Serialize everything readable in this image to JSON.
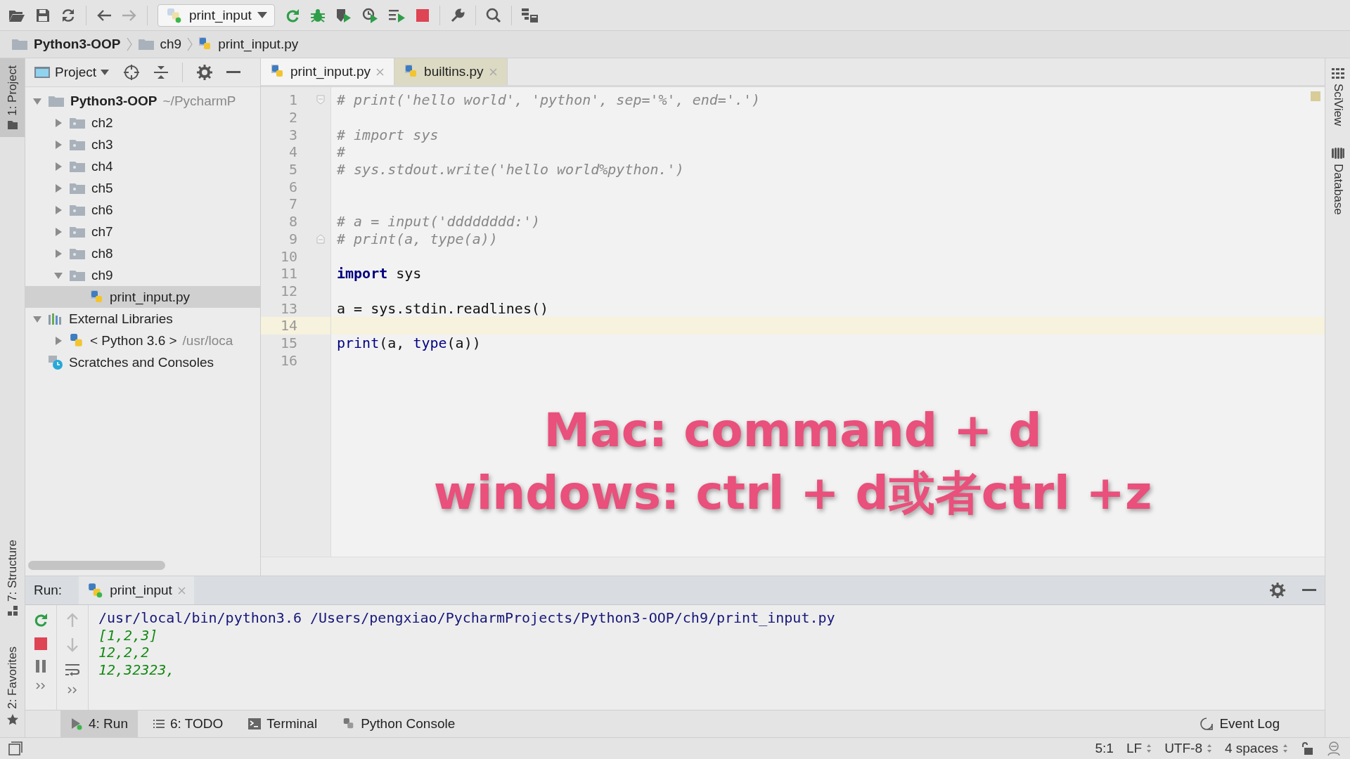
{
  "toolbar": {
    "run_config": "print_input"
  },
  "breadcrumbs": [
    {
      "label": "Python3-OOP",
      "kind": "project"
    },
    {
      "label": "ch9",
      "kind": "folder"
    },
    {
      "label": "print_input.py",
      "kind": "file"
    }
  ],
  "left_stripe": [
    {
      "label": "1: Project",
      "selected": true,
      "kind": "project"
    },
    {
      "label": "7: Structure",
      "selected": false,
      "kind": "structure"
    },
    {
      "label": "2: Favorites",
      "selected": false,
      "kind": "favorites"
    }
  ],
  "right_stripe": [
    {
      "label": "SciView",
      "kind": "sciview"
    },
    {
      "label": "Database",
      "kind": "database"
    }
  ],
  "project_panel": {
    "title": "Project",
    "tree": [
      {
        "label": "Python3-OOP",
        "hint": "~/PycharmP",
        "kind": "project",
        "expanded": true,
        "selected": false,
        "children": [
          {
            "label": "ch2",
            "kind": "folder",
            "expanded": false,
            "selected": false
          },
          {
            "label": "ch3",
            "kind": "folder",
            "expanded": false,
            "selected": false
          },
          {
            "label": "ch4",
            "kind": "folder",
            "expanded": false,
            "selected": false
          },
          {
            "label": "ch5",
            "kind": "folder",
            "expanded": false,
            "selected": false
          },
          {
            "label": "ch6",
            "kind": "folder",
            "expanded": false,
            "selected": false
          },
          {
            "label": "ch7",
            "kind": "folder",
            "expanded": false,
            "selected": false
          },
          {
            "label": "ch8",
            "kind": "folder",
            "expanded": false,
            "selected": false
          },
          {
            "label": "ch9",
            "kind": "folder",
            "expanded": true,
            "selected": false,
            "children": [
              {
                "label": "print_input.py",
                "kind": "file",
                "selected": true
              }
            ]
          }
        ]
      },
      {
        "label": "External Libraries",
        "kind": "library",
        "expanded": true,
        "selected": false,
        "children": [
          {
            "label": "< Python 3.6 >",
            "hint": "/usr/loca",
            "kind": "sdk",
            "expanded": false,
            "selected": false
          }
        ]
      },
      {
        "label": "Scratches and Consoles",
        "kind": "scratches",
        "selected": false
      }
    ]
  },
  "editor": {
    "tabs": [
      {
        "label": "print_input.py",
        "selected": true
      },
      {
        "label": "builtins.py",
        "selected": false
      }
    ],
    "lines": [
      {
        "number": "1",
        "kind": "fold_start",
        "current": false,
        "tokens": [
          {
            "text": "# print('hello world', 'python', sep='%', end='.')",
            "kind": "comment"
          }
        ]
      },
      {
        "number": "2",
        "current": false
      },
      {
        "number": "3",
        "current": false,
        "tokens": [
          {
            "text": "# import sys",
            "kind": "comment"
          }
        ]
      },
      {
        "number": "4",
        "current": false,
        "tokens": [
          {
            "text": "#",
            "kind": "comment"
          }
        ]
      },
      {
        "number": "5",
        "current": false,
        "tokens": [
          {
            "text": "# sys.stdout.write('hello world%python.')",
            "kind": "comment"
          }
        ]
      },
      {
        "number": "6",
        "current": false
      },
      {
        "number": "7",
        "current": false
      },
      {
        "number": "8",
        "current": false,
        "tokens": [
          {
            "text": "# a = input('dddddddd:')",
            "kind": "comment"
          }
        ]
      },
      {
        "number": "9",
        "kind": "fold_end",
        "current": false,
        "tokens": [
          {
            "text": "# print(a, type(a))",
            "kind": "comment"
          }
        ]
      },
      {
        "number": "10",
        "current": false
      },
      {
        "number": "11",
        "current": false,
        "tokens": [
          {
            "text": "import",
            "kind": "keyword"
          },
          {
            "text": " sys",
            "kind": "plain"
          }
        ]
      },
      {
        "number": "12",
        "current": false
      },
      {
        "number": "13",
        "current": false,
        "tokens": [
          {
            "text": "a = sys.stdin.readlines()",
            "kind": "plain"
          }
        ]
      },
      {
        "number": "14",
        "current": true
      },
      {
        "number": "15",
        "current": false,
        "tokens": [
          {
            "text": "print",
            "kind": "builtin"
          },
          {
            "text": "(a, ",
            "kind": "plain"
          },
          {
            "text": "type",
            "kind": "builtin"
          },
          {
            "text": "(a))",
            "kind": "plain"
          }
        ]
      },
      {
        "number": "16",
        "current": false
      }
    ],
    "caption": [
      "Mac: command + d",
      "windows: ctrl + d或者ctrl +z"
    ]
  },
  "run_panel": {
    "label": "Run:",
    "tab": "print_input",
    "output": [
      {
        "text": "/usr/local/bin/python3.6 /Users/pengxiao/PycharmProjects/Python3-OOP/ch9/print_input.py",
        "kind": "command"
      },
      {
        "text": "[1,2,3]",
        "kind": "input"
      },
      {
        "text": "12,2,2",
        "kind": "input"
      },
      {
        "text": "12,32323,",
        "kind": "input"
      }
    ]
  },
  "tool_tabs": [
    {
      "label": "4: Run",
      "kind": "run",
      "selected": true
    },
    {
      "label": "6: TODO",
      "kind": "todo",
      "selected": false
    },
    {
      "label": "Terminal",
      "kind": "terminal",
      "selected": false
    },
    {
      "label": "Python Console",
      "kind": "console",
      "selected": false
    }
  ],
  "event_log": "Event Log",
  "status_bar": {
    "position": "5:1",
    "line_separator": "LF",
    "encoding": "UTF-8",
    "indent": "4 spaces"
  }
}
